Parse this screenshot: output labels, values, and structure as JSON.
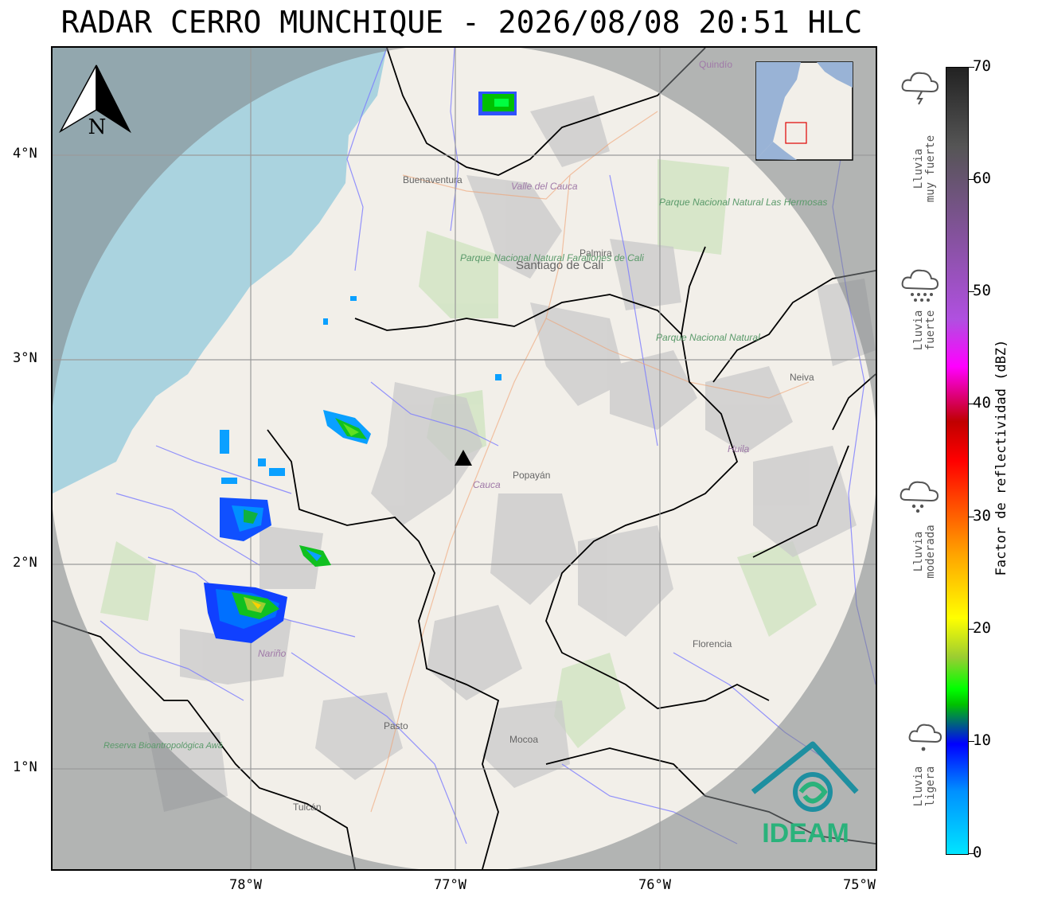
{
  "title": "RADAR CERRO MUNCHIQUE - 2026/08/08 20:51 HLC",
  "axes": {
    "lon_ticks": [
      "78°W",
      "77°W",
      "76°W",
      "75°W"
    ],
    "lat_ticks": [
      "4°N",
      "3°N",
      "2°N",
      "1°N"
    ]
  },
  "map": {
    "north_arrow_label": "N",
    "radar_site": "radar-triangle",
    "place_labels": [
      "Buenaventura",
      "Valle del Cauca",
      "Palmira",
      "Santiago de Cali",
      "Parque Nacional Natural Farallones de Cali",
      "Parque Nacional Natural Las Hermosas",
      "Parque Nacional Natural",
      "Neiva",
      "Huila",
      "Cauca",
      "Popayán",
      "Nariño",
      "Pasto",
      "Mocoa",
      "Florencia",
      "Tulcán",
      "Reserva Bioantropológica Awá",
      "Quindío"
    ],
    "brand": "IDEAM"
  },
  "colorbar": {
    "label": "Factor de reflectividad (dBZ)",
    "ticks": [
      "0",
      "10",
      "20",
      "30",
      "40",
      "50",
      "60",
      "70"
    ],
    "ticks_values": [
      0,
      10,
      20,
      30,
      40,
      50,
      60,
      70
    ],
    "range": [
      0,
      70
    ]
  },
  "rain_levels": [
    {
      "label_line1": "Lluvia",
      "label_line2": "muy fuerte",
      "icon": "storm-cloud-icon"
    },
    {
      "label_line1": "Lluvia",
      "label_line2": "fuerte",
      "icon": "heavy-rain-cloud-icon"
    },
    {
      "label_line1": "Lluvia",
      "label_line2": "moderada",
      "icon": "moderate-rain-cloud-icon"
    },
    {
      "label_line1": "Lluvia",
      "label_line2": "ligera",
      "icon": "light-rain-cloud-icon"
    }
  ],
  "colors": {
    "out_of_range_mask": "#9ea3a5",
    "ocean": "#aad3df",
    "land": "#f2efe9",
    "brand_teal": "#1e8fa0",
    "brand_green": "#2ab27b"
  }
}
